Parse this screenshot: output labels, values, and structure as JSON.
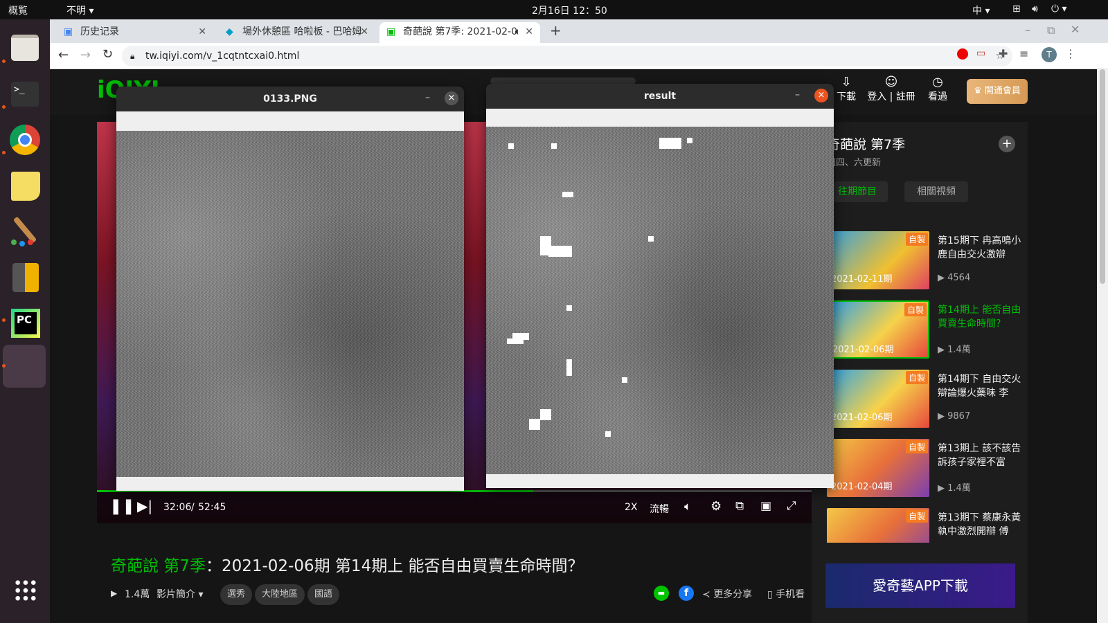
{
  "topbar": {
    "activities": "概覧",
    "app_menu": "不明",
    "clock": "2月16日 12：50",
    "input_method": "中"
  },
  "browser": {
    "tabs": [
      {
        "label": "历史记录",
        "icon": "history-icon",
        "active": false
      },
      {
        "label": "場外休憩區 哈啦板 - 巴哈姆",
        "icon": "bahamut-icon",
        "active": false
      },
      {
        "label": "奇葩說 第7季: 2021-02-0",
        "icon": "iqiyi-icon",
        "active": true
      }
    ],
    "new_tab": "+",
    "url": "tw.iqiyi.com/v_1cqtntcxai0.html",
    "profile_initial": "T"
  },
  "iqiyi": {
    "header": {
      "logo": "iQIYI",
      "download": "下載",
      "login": "登入",
      "register": "註冊",
      "watch": "看過",
      "vip": "開通會員"
    },
    "player": {
      "current_time": "32:06",
      "separator": "/",
      "total_time": "52:45",
      "speed": "2X",
      "quality": "流暢"
    },
    "video": {
      "show": "奇葩說 第7季",
      "colon": "：",
      "episode": "2021-02-06期 第14期上 能否自由買賣生命時間？",
      "views": "1.4萬",
      "intro": "影片簡介",
      "tags": [
        "選秀",
        "大陸地區",
        "國語"
      ],
      "share_more": "更多分享",
      "mobile": "手机看"
    },
    "sidebar": {
      "title": "奇葩說 第7季",
      "schedule": "週四、六更新",
      "tabs": [
        "往期節目",
        "相關視頻"
      ],
      "items": [
        {
          "title": "第15期下 冉高鳴小鹿自由交火激辯",
          "date": "2021-02-11期",
          "views": "4564",
          "badge": "自製",
          "active": false
        },
        {
          "title": "第14期上 能否自由買賣生命時間？",
          "date": "2021-02-06期",
          "views": "1.4萬",
          "badge": "自製",
          "active": true
        },
        {
          "title": "第14期下 自由交火辯論爆火藥味 李",
          "date": "2021-02-06期",
          "views": "9867",
          "badge": "自製",
          "active": false
        },
        {
          "title": "第13期上 該不該告訴孩子家裡不富",
          "date": "2021-02-04期",
          "views": "1.4萬",
          "badge": "自製",
          "active": false
        },
        {
          "title": "第13期下 蔡康永黃執中激烈開辯 傅",
          "date": "",
          "views": "",
          "badge": "自製",
          "active": false
        }
      ],
      "app_banner": "愛奇藝APP下載"
    }
  },
  "windows": {
    "left": {
      "title": "0133.PNG",
      "minimize": "–",
      "close": "×"
    },
    "right": {
      "title": "result",
      "minimize": "–",
      "close": "×"
    }
  },
  "colors": {
    "iqiyi_green": "#00be06",
    "close_orange": "#e95420",
    "dock_bg": "#2b2229"
  }
}
